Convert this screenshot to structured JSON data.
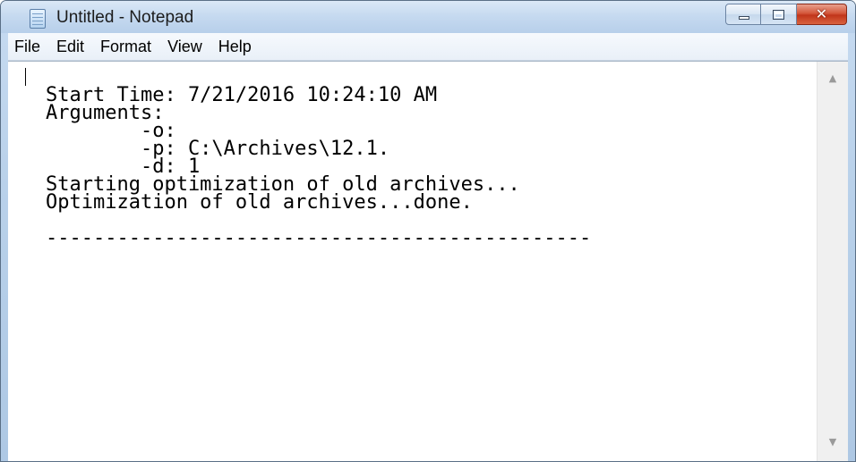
{
  "window": {
    "title": "Untitled - Notepad",
    "icon": "notepad-icon"
  },
  "caption_buttons": {
    "minimize_icon": "minimize-icon",
    "maximize_icon": "maximize-icon",
    "close_icon": "close-icon",
    "close_glyph": "✕"
  },
  "menu": {
    "items": [
      "File",
      "Edit",
      "Format",
      "View",
      "Help"
    ]
  },
  "document": {
    "text": "Start Time: 7/21/2016 10:24:10 AM\nArguments:\n        -o:\n        -p: C:\\Archives\\12.1.\n        -d: 1\nStarting optimization of old archives...\nOptimization of old archives...done.\n\n----------------------------------------------"
  },
  "scrollbar": {
    "up_glyph": "▲",
    "down_glyph": "▼"
  },
  "colors": {
    "close_button": "#c7391d",
    "frame": "#b9d1ea"
  }
}
